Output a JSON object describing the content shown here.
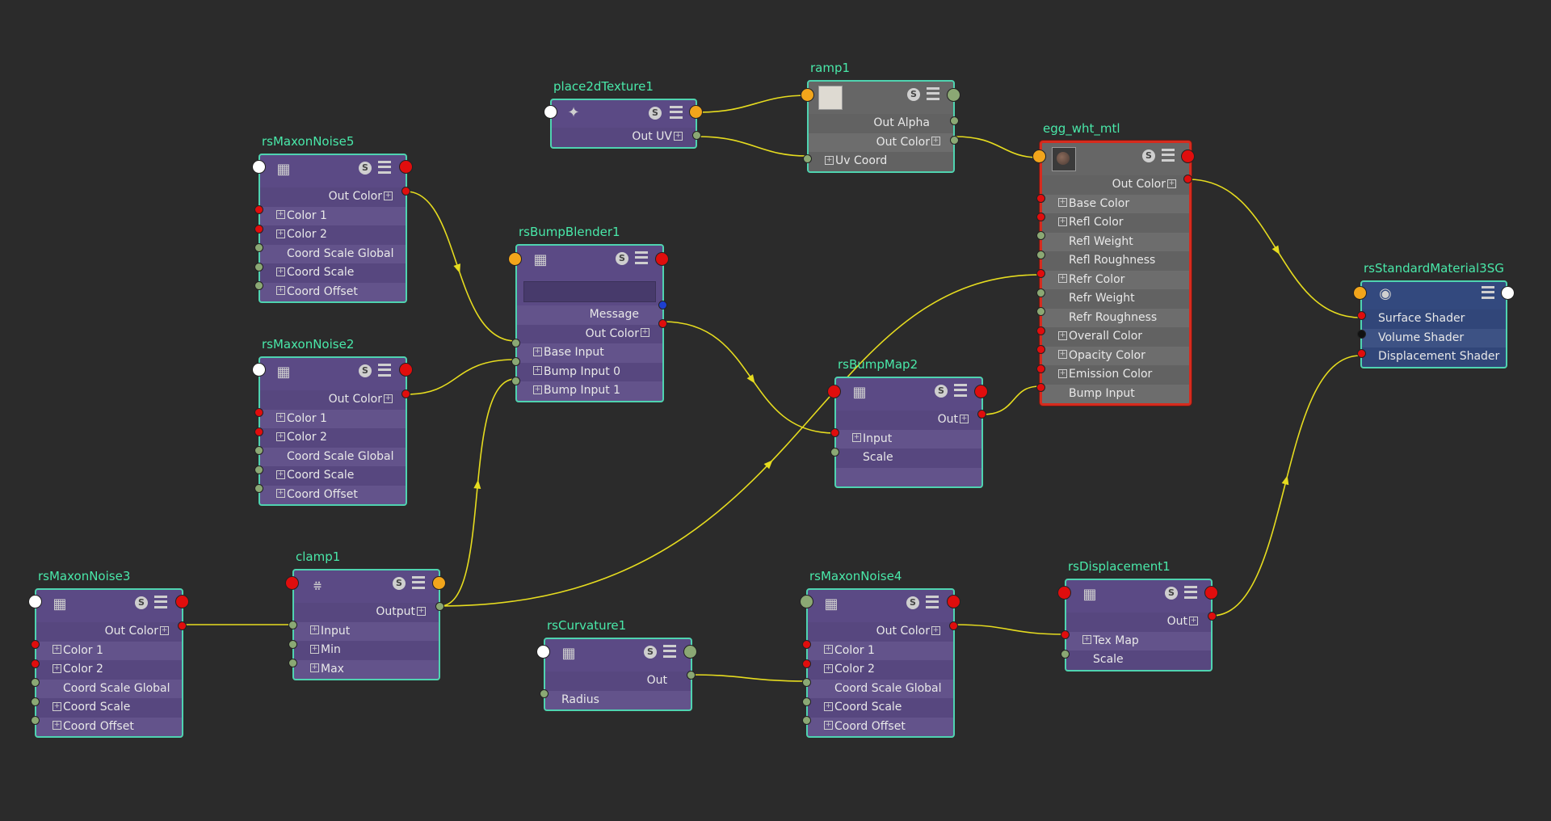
{
  "colors": {
    "background": "#2b2b2b",
    "node_border": "#4fd3b0",
    "node_title": "#49e8a9",
    "node_purple": "#5b4a85",
    "node_gray": "#666666",
    "node_blue": "#33497e",
    "selected_border": "#d62b1e",
    "wire": "#e6dc1f"
  },
  "nodes": {
    "place2dTexture1": {
      "title": "place2dTexture1",
      "icon": "place2d-texture-icon",
      "outputs": [
        "Out UV"
      ]
    },
    "ramp1": {
      "title": "ramp1",
      "icon": "ramp-swatch",
      "outputs": [
        "Out Alpha",
        "Out Color"
      ],
      "inputs": [
        "Uv Coord"
      ]
    },
    "egg_wht_mtl": {
      "title": "egg_wht_mtl",
      "icon": "material-ball-swatch",
      "outputs": [
        "Out Color"
      ],
      "inputs": [
        "Base Color",
        "Refl Color",
        "Refl Weight",
        "Refl Roughness",
        "Refr Color",
        "Refr Weight",
        "Refr Roughness",
        "Overall Color",
        "Opacity Color",
        "Emission Color",
        "Bump Input"
      ]
    },
    "rsStandardMaterial3SG": {
      "title": "rsStandardMaterial3SG",
      "icon": "shading-group-icon",
      "inputs": [
        "Surface Shader",
        "Volume Shader",
        "Displacement Shader"
      ]
    },
    "rsMaxonNoise5": {
      "title": "rsMaxonNoise5",
      "icon": "noise-texture-icon",
      "outputs": [
        "Out Color"
      ],
      "inputs": [
        "Color 1",
        "Color 2",
        "Coord Scale Global",
        "Coord Scale",
        "Coord Offset"
      ]
    },
    "rsMaxonNoise2": {
      "title": "rsMaxonNoise2",
      "icon": "noise-texture-icon",
      "outputs": [
        "Out Color"
      ],
      "inputs": [
        "Color 1",
        "Color 2",
        "Coord Scale Global",
        "Coord Scale",
        "Coord Offset"
      ]
    },
    "rsBumpBlender1": {
      "title": "rsBumpBlender1",
      "icon": "texture-icon",
      "outputs": [
        "Message",
        "Out Color"
      ],
      "inputs": [
        "Base Input",
        "Bump Input 0",
        "Bump Input 1"
      ]
    },
    "rsBumpMap2": {
      "title": "rsBumpMap2",
      "icon": "texture-icon",
      "outputs": [
        "Out"
      ],
      "inputs": [
        "Input",
        "Scale"
      ]
    },
    "rsMaxonNoise3": {
      "title": "rsMaxonNoise3",
      "icon": "noise-texture-icon",
      "outputs": [
        "Out Color"
      ],
      "inputs": [
        "Color 1",
        "Color 2",
        "Coord Scale Global",
        "Coord Scale",
        "Coord Offset"
      ]
    },
    "clamp1": {
      "title": "clamp1",
      "icon": "clamp-icon",
      "outputs": [
        "Output"
      ],
      "inputs": [
        "Input",
        "Min",
        "Max"
      ]
    },
    "rsCurvature1": {
      "title": "rsCurvature1",
      "icon": "texture-icon",
      "outputs": [
        "Out"
      ],
      "inputs": [
        "Radius"
      ]
    },
    "rsMaxonNoise4": {
      "title": "rsMaxonNoise4",
      "icon": "noise-texture-icon",
      "outputs": [
        "Out Color"
      ],
      "inputs": [
        "Color 1",
        "Color 2",
        "Coord Scale Global",
        "Coord Scale",
        "Coord Offset"
      ]
    },
    "rsDisplacement1": {
      "title": "rsDisplacement1",
      "icon": "texture-icon",
      "outputs": [
        "Out"
      ],
      "inputs": [
        "Tex Map",
        "Scale"
      ]
    }
  },
  "header_buttons": {
    "swatch_toggle": "S"
  },
  "connections": [
    [
      "place2dTexture1.Out UV",
      "ramp1.Uv Coord"
    ],
    [
      "place2dTexture1.out",
      "ramp1.in"
    ],
    [
      "ramp1.Out Color",
      "egg_wht_mtl.in"
    ],
    [
      "egg_wht_mtl.Out Color",
      "rsStandardMaterial3SG.Surface Shader"
    ],
    [
      "rsMaxonNoise5.Out Color",
      "rsBumpBlender1.Base Input"
    ],
    [
      "rsMaxonNoise2.Out Color",
      "rsBumpBlender1.Bump Input 0"
    ],
    [
      "clamp1.Output",
      "rsBumpBlender1.Bump Input 1"
    ],
    [
      "rsBumpBlender1.Out Color",
      "rsBumpMap2.Input"
    ],
    [
      "rsBumpMap2.Out",
      "egg_wht_mtl.Bump Input"
    ],
    [
      "clamp1.Output",
      "egg_wht_mtl.Refr Color"
    ],
    [
      "rsMaxonNoise3.Out Color",
      "clamp1.Input"
    ],
    [
      "rsCurvature1.Out",
      "rsMaxonNoise4.Coord Scale Global"
    ],
    [
      "rsMaxonNoise4.Out Color",
      "rsDisplacement1.Tex Map"
    ],
    [
      "rsDisplacement1.Out",
      "rsStandardMaterial3SG.Displacement Shader"
    ]
  ]
}
